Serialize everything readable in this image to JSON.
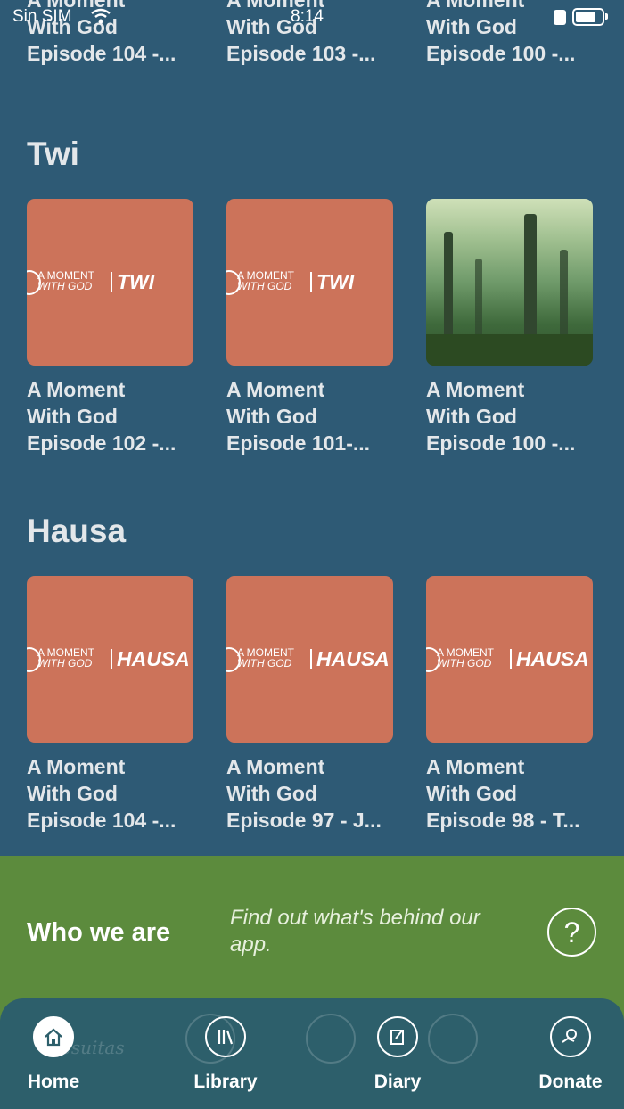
{
  "status_bar": {
    "carrier": "Sin SIM",
    "time": "8:14"
  },
  "top_row": [
    {
      "caption_lines": [
        "A Moment",
        "With God",
        "Episode 104 -..."
      ]
    },
    {
      "caption_lines": [
        "A Moment",
        "With God",
        "Episode 103 -..."
      ]
    },
    {
      "caption_lines": [
        "A Moment",
        "With God",
        "Episode 100 -..."
      ]
    }
  ],
  "sections": [
    {
      "title": "Twi",
      "items": [
        {
          "thumb": {
            "logo_top": "A MOMENT",
            "logo_bottom": "WITH GOD",
            "language": "TWI"
          },
          "caption_lines": [
            "A Moment",
            "With God",
            "Episode 102 -..."
          ]
        },
        {
          "thumb": {
            "logo_top": "A MOMENT",
            "logo_bottom": "WITH GOD",
            "language": "TWI"
          },
          "caption_lines": [
            "A Moment",
            "With God",
            "Episode 101-..."
          ]
        },
        {
          "thumb": {
            "image": "forest-photo"
          },
          "caption_lines": [
            "A Moment",
            "With God",
            "Episode 100 -..."
          ]
        }
      ]
    },
    {
      "title": "Hausa",
      "items": [
        {
          "thumb": {
            "logo_top": "A MOMENT",
            "logo_bottom": "WITH GOD",
            "language": "HAUSA"
          },
          "caption_lines": [
            "A Moment",
            "With God",
            "Episode 104 -..."
          ]
        },
        {
          "thumb": {
            "logo_top": "A MOMENT",
            "logo_bottom": "WITH GOD",
            "language": "HAUSA"
          },
          "caption_lines": [
            "A Moment",
            "With God",
            "Episode 97 - J..."
          ]
        },
        {
          "thumb": {
            "logo_top": "A MOMENT",
            "logo_bottom": "WITH GOD",
            "language": "HAUSA"
          },
          "caption_lines": [
            "A Moment",
            "With God",
            "Episode 98 - T..."
          ]
        }
      ]
    }
  ],
  "who_we_are": {
    "title": "Who we are",
    "description": "Find out what's behind our app.",
    "icon": "help-circle-icon"
  },
  "tab_bar": {
    "tabs": [
      {
        "label": "Home",
        "icon": "home-icon"
      },
      {
        "label": "Library",
        "icon": "library-icon"
      },
      {
        "label": "Diary",
        "icon": "diary-icon"
      },
      {
        "label": "Donate",
        "icon": "donate-icon"
      }
    ],
    "watermark": "Jesuitas"
  },
  "colors": {
    "background": "#2e5a75",
    "thumb": "#cc735a",
    "who_banner": "#5c8b3d",
    "tab_bar": "#2d5f6b"
  }
}
